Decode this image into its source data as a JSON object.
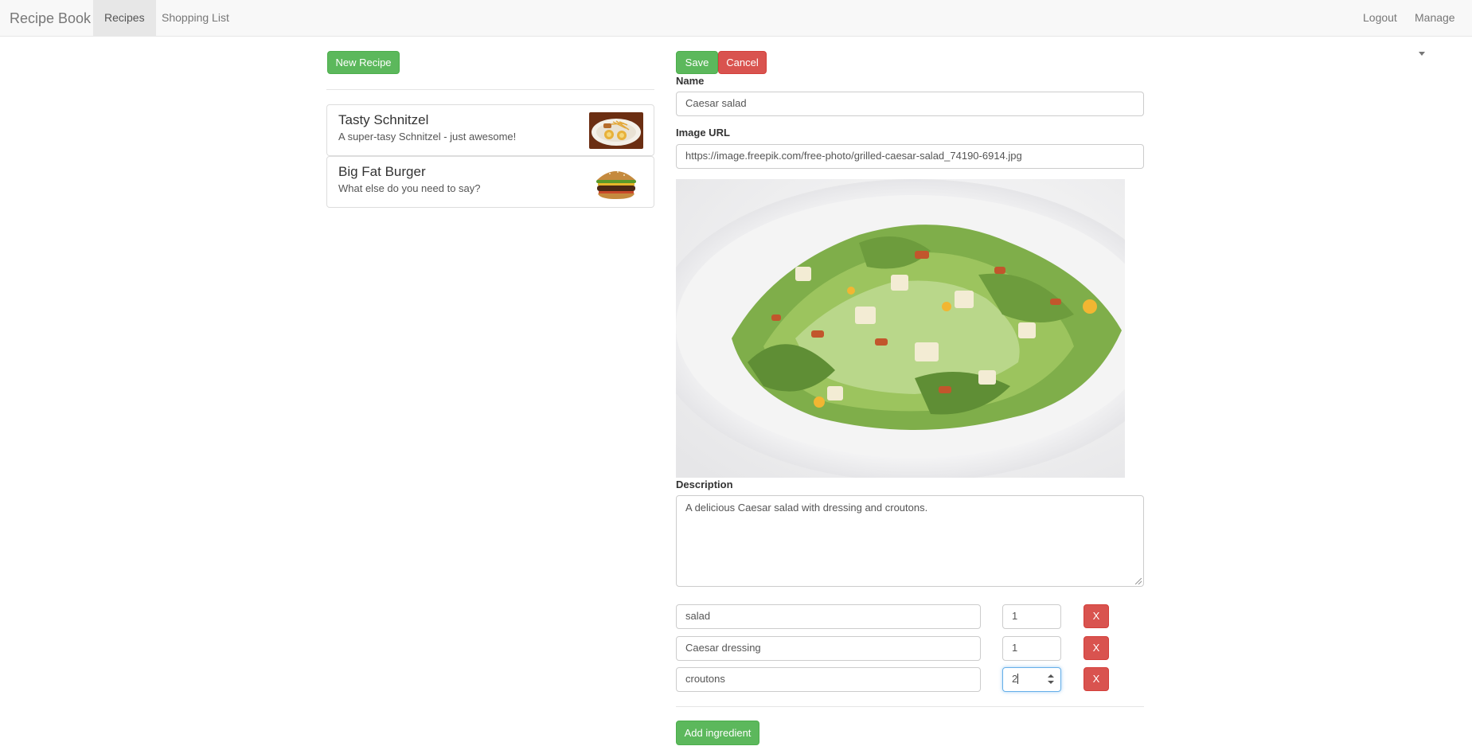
{
  "navbar": {
    "brand": "Recipe Book",
    "links": [
      {
        "label": "Recipes",
        "active": true
      },
      {
        "label": "Shopping List",
        "active": false
      }
    ],
    "right": {
      "logout": "Logout",
      "manage": "Manage"
    }
  },
  "list": {
    "new_recipe_label": "New Recipe",
    "recipes": [
      {
        "title": "Tasty Schnitzel",
        "description": "A super-tasy Schnitzel - just awesome!",
        "image_icon": "schnitzel-image"
      },
      {
        "title": "Big Fat Burger",
        "description": "What else do you need to say?",
        "image_icon": "burger-image"
      }
    ]
  },
  "form": {
    "save_label": "Save",
    "cancel_label": "Cancel",
    "name_label": "Name",
    "name_value": "Caesar salad",
    "image_url_label": "Image URL",
    "image_url_value": "https://image.freepik.com/free-photo/grilled-caesar-salad_74190-6914.jpg",
    "preview_icon": "caesar-salad-image",
    "description_label": "Description",
    "description_value": "A delicious Caesar salad with dressing and croutons.",
    "ingredients": [
      {
        "name": "salad",
        "amount": "1",
        "delete_label": "X"
      },
      {
        "name": "Caesar dressing",
        "amount": "1",
        "delete_label": "X"
      },
      {
        "name": "croutons",
        "amount": "2",
        "delete_label": "X"
      }
    ],
    "add_ingredient_label": "Add ingredient"
  },
  "colors": {
    "success": "#5cb85c",
    "danger": "#d9534f",
    "navbar_bg": "#f8f8f8",
    "focus_border": "#66afe9"
  }
}
